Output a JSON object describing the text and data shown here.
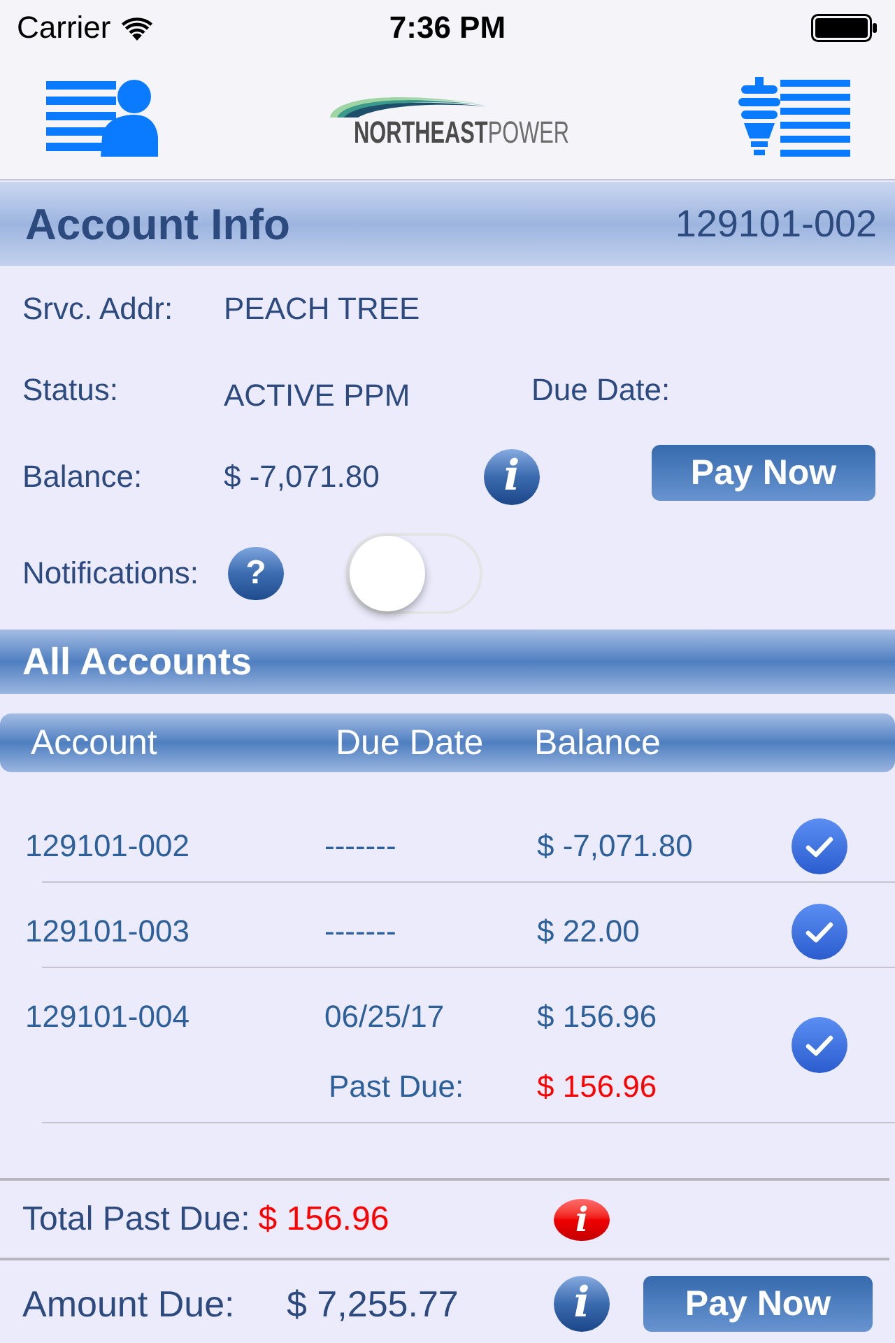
{
  "status_bar": {
    "carrier": "Carrier",
    "time": "7:36 PM"
  },
  "header": {
    "logo_text": "**NORTHEAST**POWER"
  },
  "account_info": {
    "title": "Account Info",
    "account_number": "129101-002",
    "service_address": {
      "label": "Srvc. Addr:",
      "value": "PEACH TREE"
    },
    "status": {
      "label": "Status:",
      "value": "ACTIVE PPM"
    },
    "due_date": {
      "label": "Due Date:"
    },
    "balance": {
      "label": "Balance:",
      "value": "$ -7,071.80",
      "info_button": {
        "kind": "info",
        "glyph": "i"
      }
    },
    "pay_button": "Pay Now",
    "notifications": {
      "label": "Notifications:",
      "help_button": {
        "kind": "help",
        "glyph": "?"
      },
      "on": false
    }
  },
  "all_accounts": {
    "title": "All Accounts",
    "columns": [
      "Account",
      "Due Date",
      "Balance"
    ],
    "rows": [
      {
        "account": "129101-002",
        "due_date": "-------",
        "balance": "$ -7,071.80",
        "checked": true
      },
      {
        "account": "129101-003",
        "due_date": "-------",
        "balance": "$ 22.00",
        "checked": true
      },
      {
        "account": "129101-004",
        "due_date": "06/25/17",
        "balance": "$ 156.96",
        "checked": true,
        "past_due": {
          "label": "Past Due:",
          "value": "$ 156.96"
        }
      }
    ]
  },
  "totals": {
    "total_past_due": {
      "label": "Total Past Due:",
      "value": "$ 156.96",
      "info_button": {
        "kind": "alert",
        "glyph": "i"
      }
    },
    "amount_due": {
      "label": "Amount Due:",
      "value": "$ 7,255.77",
      "info_button": {
        "kind": "info",
        "glyph": "i"
      },
      "pay_button": "Pay Now"
    }
  }
}
